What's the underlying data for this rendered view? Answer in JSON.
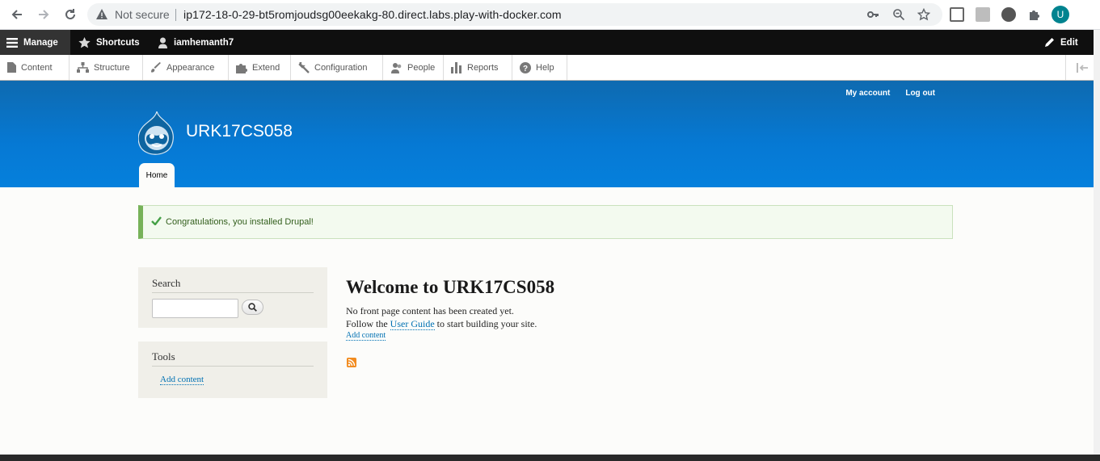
{
  "browser": {
    "security_label": "Not secure",
    "url": "ip172-18-0-29-bt5romjoudsg00eekakg-80.direct.labs.play-with-docker.com",
    "profile_initial": "U"
  },
  "toolbar": {
    "manage": "Manage",
    "shortcuts": "Shortcuts",
    "user": "iamhemanth7",
    "edit": "Edit"
  },
  "tray": {
    "items": [
      "Content",
      "Structure",
      "Appearance",
      "Extend",
      "Configuration",
      "People",
      "Reports",
      "Help"
    ]
  },
  "header": {
    "my_account": "My account",
    "log_out": "Log out",
    "site_name": "URK17CS058",
    "home_tab": "Home"
  },
  "message": {
    "text": "Congratulations, you installed Drupal!"
  },
  "sidebar": {
    "search_title": "Search",
    "tools_title": "Tools",
    "add_content": "Add content"
  },
  "main": {
    "title": "Welcome to URK17CS058",
    "line1": "No front page content has been created yet.",
    "line2_prefix": "Follow the",
    "user_guide": "User Guide",
    "line2_suffix": "to start building your site.",
    "add_content": "Add content"
  },
  "colors": {
    "header_blue": "#0679d4",
    "toolbar_black": "#0f0f0f",
    "status_green": "#77b259",
    "link_blue": "#0071b3"
  }
}
